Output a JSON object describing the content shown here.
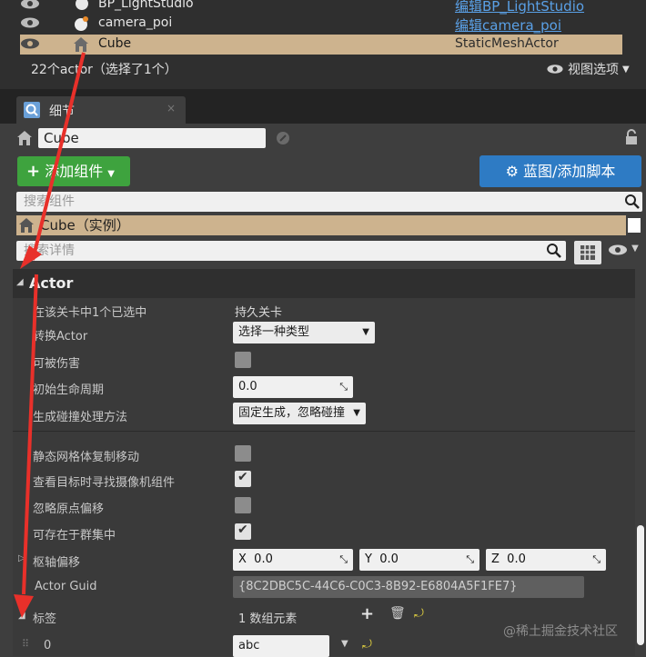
{
  "outliner": {
    "rows": [
      {
        "name": "BP_LightStudio",
        "type": "编辑BP_LightStudio"
      },
      {
        "name": "camera_poi",
        "type": "编辑camera_poi"
      },
      {
        "name": "Cube",
        "type": "StaticMeshActor"
      }
    ],
    "count": "22个actor（选择了1个）",
    "view_options": "视图选项"
  },
  "details_tab": {
    "label": "细节"
  },
  "actor_name": "Cube",
  "buttons": {
    "add_component": "添加组件",
    "blueprint": "蓝图/添加脚本"
  },
  "search_components": {
    "placeholder": "搜索组件"
  },
  "instance_label": "Cube（实例）",
  "search_details": {
    "placeholder": "搜索详情"
  },
  "section": {
    "title": "Actor"
  },
  "props": {
    "selected_in_level": {
      "label": "在该关卡中1个已选中",
      "value": "持久关卡"
    },
    "convert_actor": {
      "label": "转换Actor",
      "value": "选择一种类型"
    },
    "can_be_damaged": {
      "label": "可被伤害"
    },
    "initial_lifespan": {
      "label": "初始生命周期",
      "value": "0.0"
    },
    "spawn_collision": {
      "label": "生成碰撞处理方法",
      "value": "固定生成，忽略碰撞"
    },
    "replicate_movement": {
      "label": "静态网格体复制移动"
    },
    "find_camera": {
      "label": "查看目标时寻找摄像机组件"
    },
    "ignore_origin": {
      "label": "忽略原点偏移"
    },
    "can_exist_cluster": {
      "label": "可存在于群集中"
    },
    "pivot_offset": {
      "label": "枢轴偏移",
      "x": "0.0",
      "y": "0.0",
      "z": "0.0",
      "xl": "X",
      "yl": "Y",
      "zl": "Z"
    },
    "actor_guid": {
      "label": "Actor Guid",
      "value": "{8C2DBC5C-44C6-C0C3-8B92-E6804A5F1FE7}"
    }
  },
  "tags": {
    "title": "标签",
    "count": "1 数组元素",
    "index": "0",
    "value": "abc"
  },
  "watermark": "@稀土掘金技术社区",
  "colors": {
    "selection": "#cdb38e",
    "add_button": "#3ea33e",
    "blueprint_button": "#2e7bc4",
    "arrow": "#e8302a"
  }
}
